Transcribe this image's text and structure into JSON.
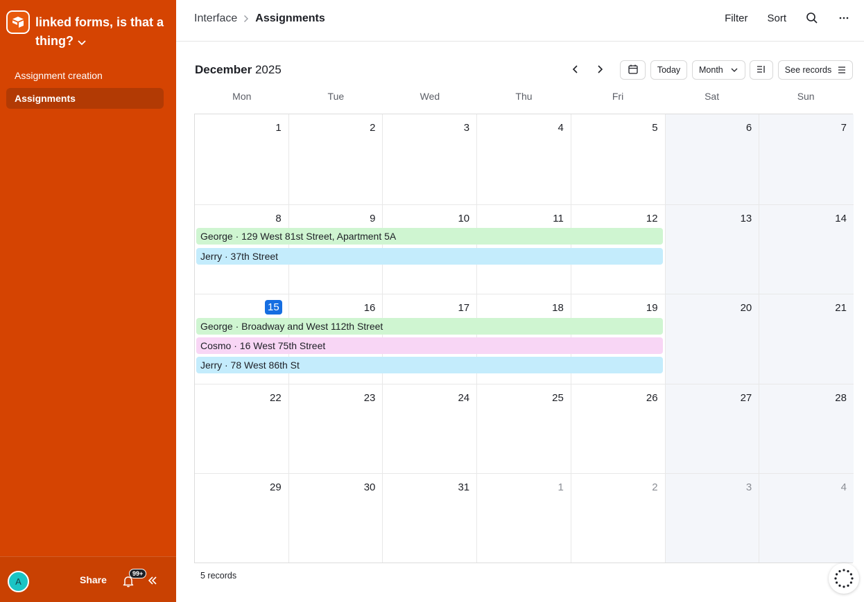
{
  "app": {
    "title": "linked forms, is that a thing?",
    "accent": "#d54402"
  },
  "sidebar": {
    "items": [
      {
        "label": "Assignment creation",
        "active": false
      },
      {
        "label": "Assignments",
        "active": true
      }
    ],
    "footer": {
      "avatar_initial": "A",
      "share_label": "Share",
      "notification_badge": "99+"
    }
  },
  "header": {
    "breadcrumb_parent": "Interface",
    "breadcrumb_current": "Assignments",
    "filter_label": "Filter",
    "sort_label": "Sort"
  },
  "calendar": {
    "month": "December",
    "year": "2025",
    "today_label": "Today",
    "view_label": "Month",
    "see_records_label": "See records",
    "weekdays": [
      "Mon",
      "Tue",
      "Wed",
      "Thu",
      "Fri",
      "Sat",
      "Sun"
    ],
    "weeks": [
      [
        "1",
        "2",
        "3",
        "4",
        "5",
        "6",
        "7"
      ],
      [
        "8",
        "9",
        "10",
        "11",
        "12",
        "13",
        "14"
      ],
      [
        "15",
        "16",
        "17",
        "18",
        "19",
        "20",
        "21"
      ],
      [
        "22",
        "23",
        "24",
        "25",
        "26",
        "27",
        "28"
      ],
      [
        "29",
        "30",
        "31",
        "1",
        "2",
        "3",
        "4"
      ]
    ],
    "today_date": "15",
    "events": [
      {
        "label": "George · 129 West 81st Street, Apartment 5A",
        "color": "#cff5d1",
        "week": 1
      },
      {
        "label": "Jerry · 37th Street",
        "color": "#c4ecfc",
        "week": 1
      },
      {
        "label": "George · Broadway and West 112th Street",
        "color": "#cff5d1",
        "week": 2
      },
      {
        "label": "Cosmo · 16 West 75th Street",
        "color": "#f8d6f5",
        "week": 2
      },
      {
        "label": "Jerry · 78 West 86th St",
        "color": "#c4ecfc",
        "week": 2
      }
    ]
  },
  "footer": {
    "records_count": "5 records"
  }
}
